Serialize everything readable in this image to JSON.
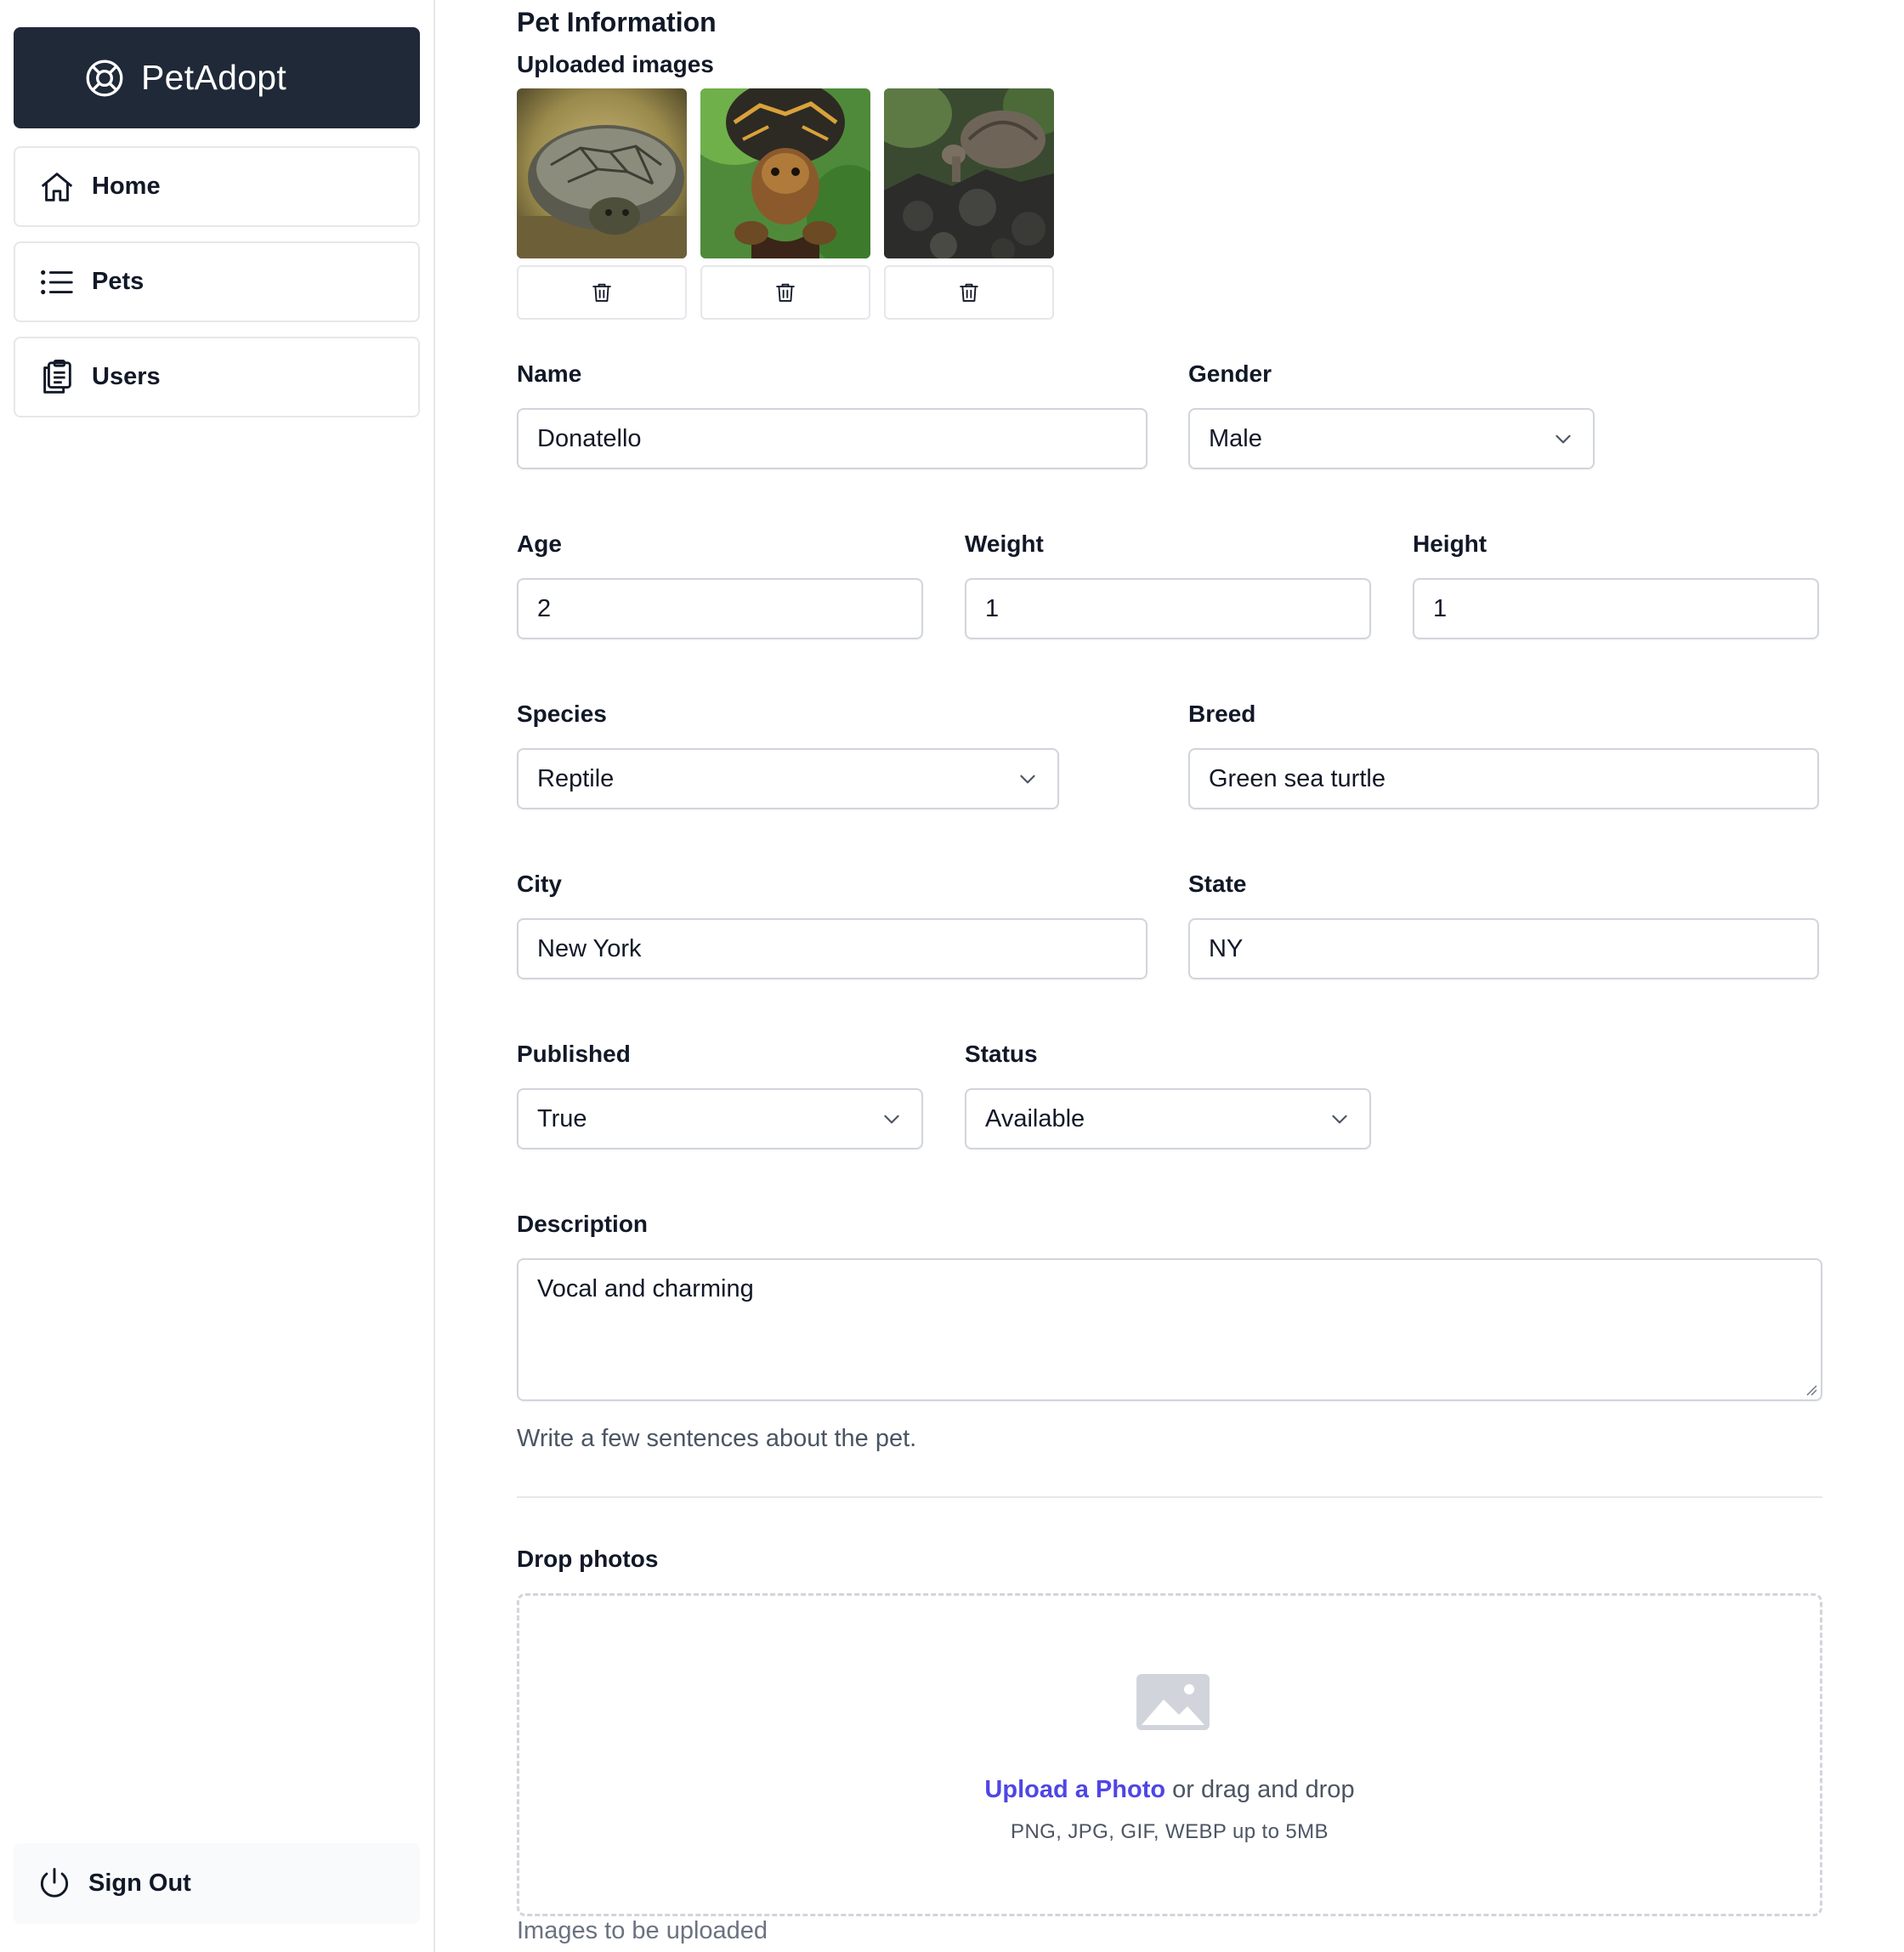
{
  "app": {
    "brand": "PetAdopt"
  },
  "sidebar": {
    "items": [
      {
        "label": "Home",
        "icon": "home-icon"
      },
      {
        "label": "Pets",
        "icon": "list-icon"
      },
      {
        "label": "Users",
        "icon": "clipboard-icon"
      }
    ],
    "signout_label": "Sign Out"
  },
  "form": {
    "title": "Pet Information",
    "uploaded_images_label": "Uploaded images",
    "uploaded_images": [
      {
        "subject": "turtle in shell close-up"
      },
      {
        "subject": "box turtle facing camera"
      },
      {
        "subject": "giant tortoise on rocks"
      }
    ],
    "name": {
      "label": "Name",
      "value": "Donatello"
    },
    "gender": {
      "label": "Gender",
      "value": "Male"
    },
    "age": {
      "label": "Age",
      "value": "2"
    },
    "weight": {
      "label": "Weight",
      "value": "1"
    },
    "height": {
      "label": "Height",
      "value": "1"
    },
    "species": {
      "label": "Species",
      "value": "Reptile"
    },
    "breed": {
      "label": "Breed",
      "value": "Green sea turtle"
    },
    "city": {
      "label": "City",
      "value": "New York"
    },
    "state": {
      "label": "State",
      "value": "NY"
    },
    "published": {
      "label": "Published",
      "value": "True"
    },
    "status": {
      "label": "Status",
      "value": "Available"
    },
    "description": {
      "label": "Description",
      "value": "Vocal and charming",
      "help": "Write a few sentences about the pet."
    },
    "dropzone": {
      "label": "Drop photos",
      "upload_link": "Upload a Photo",
      "upload_suffix": "or drag and drop",
      "hint": "PNG, JPG, GIF, WEBP up to 5MB"
    },
    "pending_label": "Images to be uploaded"
  },
  "colors": {
    "brand_bg": "#1f2937",
    "link": "#4f46e5",
    "border": "#d1d5db"
  }
}
